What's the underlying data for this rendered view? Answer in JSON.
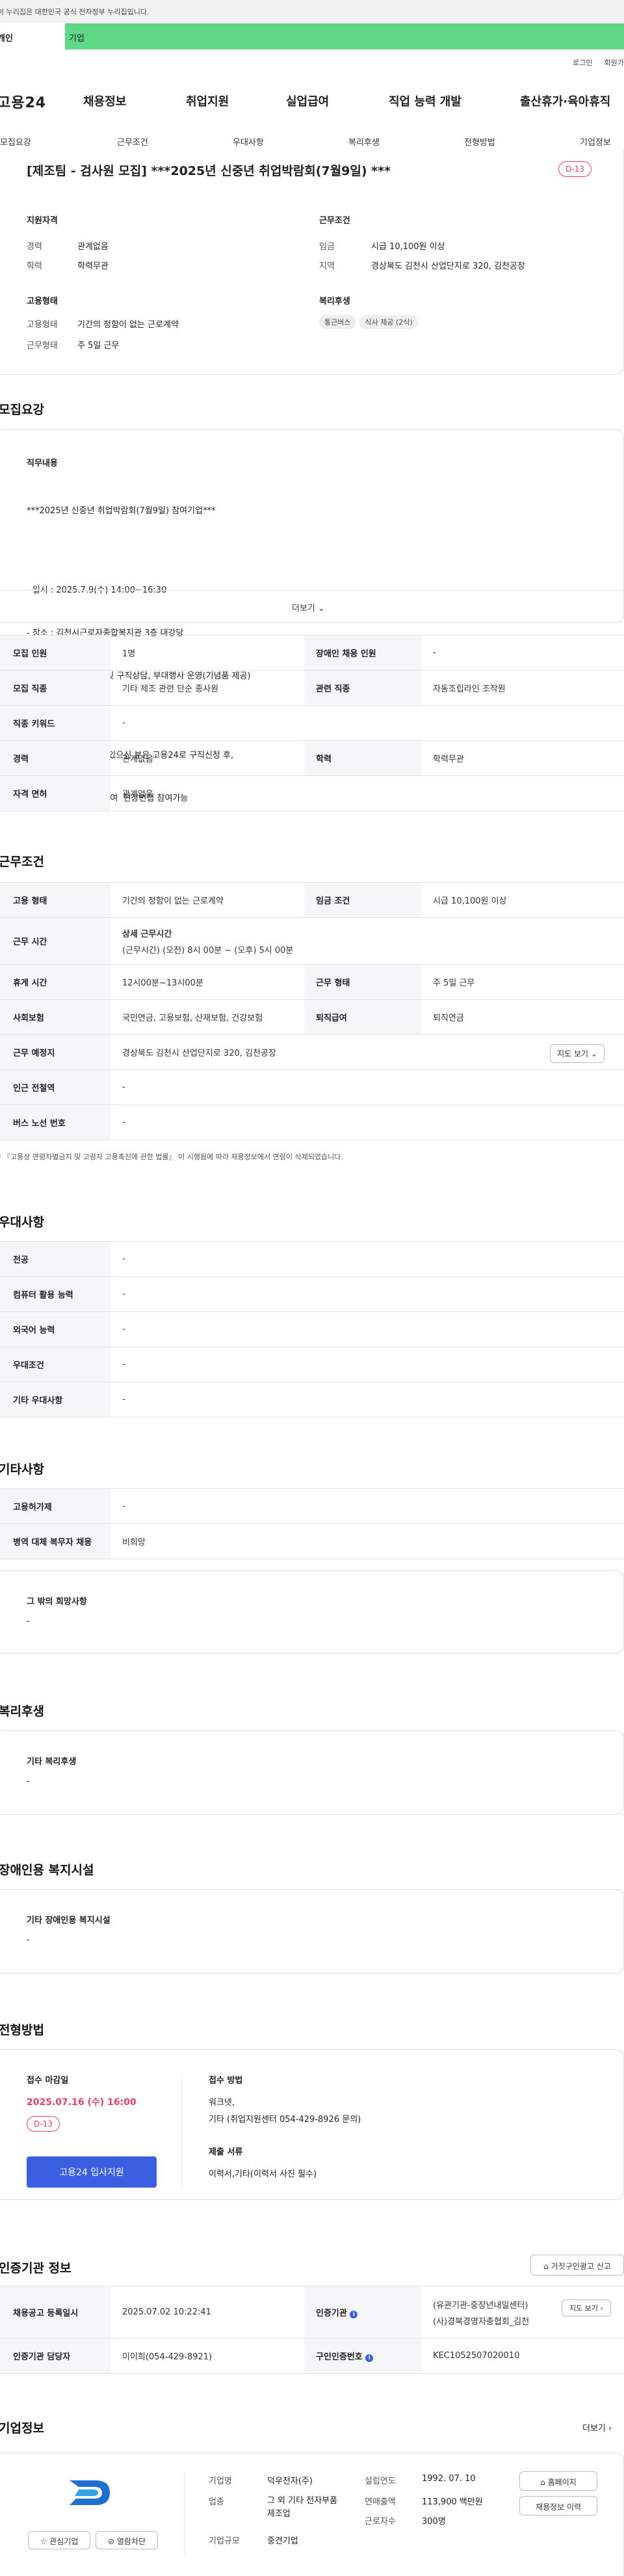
{
  "gov_banner": "이 누리집은 대한민국 공식 전자정부 누리집입니다.",
  "top_tabs": {
    "individual": "개인",
    "company": "기업"
  },
  "utility": {
    "login": "로그인",
    "join": "회원가입"
  },
  "gnb": {
    "logo": "고용24",
    "menu": [
      "채용정보",
      "취업지원",
      "실업급여",
      "직업 능력 개발",
      "출산휴가·육아휴직"
    ]
  },
  "subnav": [
    "모집요강",
    "근무조건",
    "우대사항",
    "복리후생",
    "전형방법",
    "기업정보"
  ],
  "header": {
    "title": "[제조팀 - 검사원 모집] ***2025년 신중년 취업박람회(7월9일) ***",
    "dday": "D-13",
    "qualification_title": "지원자격",
    "career_label": "경력",
    "career_value": "관계없음",
    "edu_label": "학력",
    "edu_value": "학력무관",
    "employ_title": "고용형태",
    "employ_type_label": "고용형태",
    "employ_type_value": "기간의 정함이 없는 근로계약",
    "work_type_label": "근무형태",
    "work_type_value": "주 5일 근무",
    "cond_title": "근무조건",
    "wage_label": "임금",
    "wage_value": "시급 10,100원 이상",
    "region_label": "지역",
    "region_value": "경상북도 김천시 산업단지로 320, 김천공장",
    "welfare_title": "복리후생",
    "welfare_tags": [
      "통근버스",
      "식사 제공 (2식)"
    ]
  },
  "recruit": {
    "section_title": "모집요강",
    "duty_title": "직무내용",
    "lines": [
      "***2025년 신중년 취업박람회(7월9일) 참여기업***",
      "",
      "- 일시 : 2025.7.9(수) 14:00~16:30",
      "- 장소 : 김천시근로자종합복지관 3층 대강당",
      "- 내용 : 1:1 현장면접 및 구직상담, 부대행사 운영(기념품 제공)",
      "",
      "- 지원방법 : 지원 의사 있으신 분은 고용24로 구직신청 후,",
      "  이력서, 신분증 지참하여  현장면접 참여가능"
    ],
    "more": "더보기",
    "rows": [
      {
        "h1": "모집 인원",
        "v1": "1명",
        "h2": "장애인 채용 인원",
        "v2": "-"
      },
      {
        "h1": "모집 직종",
        "v1": "기타 제조 관련 단순 종사원",
        "h2": "관련 직종",
        "v2": "자동조립라인 조작원"
      },
      {
        "h1": "직종 키워드",
        "v1": "-"
      },
      {
        "h1": "경력",
        "v1": "관계없음",
        "h2": "학력",
        "v2": "학력무관"
      },
      {
        "h1": "자격 면허",
        "v1": "관계없음"
      }
    ]
  },
  "work": {
    "section_title": "근무조건",
    "employ_h": "고용 형태",
    "employ_v": "기간의 정함이 없는 근로계약",
    "wage_h": "임금 조건",
    "wage_v": "시급 10,100원 이상",
    "time_h": "근무 시간",
    "time_title": "상세 근무시간",
    "time_v": "(근무시간) (오전) 8시 00분 ~ (오후) 5시 00분",
    "rest_h": "휴게 시간",
    "rest_v": "12시00분~13시00분",
    "worktype_h": "근무 형태",
    "worktype_v": "주 5일 근무",
    "insurance_h": "사회보험",
    "insurance_v": "국민연금, 고용보험, 산재보험, 건강보험",
    "retire_h": "퇴직급여",
    "retire_v": "퇴직연금",
    "place_h": "근무 예정지",
    "place_v": "경상북도 김천시 산업단지로 320, 김천공장",
    "map_btn": "지도 보기",
    "subway_h": "인근 전철역",
    "subway_v": "-",
    "bus_h": "버스 노선 번호",
    "bus_v": "-",
    "notice": "* 『고용상 연령차별금지 및 고령자 고용촉진에 관한 법률』 이 시행됨에 따라 채용정보에서 연령이 삭제되었습니다."
  },
  "pref": {
    "section_title": "우대사항",
    "rows": [
      {
        "h": "전공",
        "v": "-"
      },
      {
        "h": "컴퓨터 활용 능력",
        "v": "-"
      },
      {
        "h": "외국어 능력",
        "v": "-"
      },
      {
        "h": "우대조건",
        "v": "-"
      },
      {
        "h": "기타 우대사항",
        "v": "-"
      }
    ]
  },
  "etc": {
    "section_title": "기타사항",
    "rows": [
      {
        "h": "고용허가제",
        "v": "-"
      },
      {
        "h": "병역 대체 복무자 채용",
        "v": "비희망"
      }
    ],
    "other_title": "그 밖의 희망사항",
    "other_v": "-"
  },
  "welfare": {
    "section_title": "복리후생",
    "box_title": "기타 복리후생",
    "box_v": "-"
  },
  "disability": {
    "section_title": "장애인용 복지시설",
    "box_title": "기타 장애인용 복지시설",
    "box_v": "-"
  },
  "process": {
    "section_title": "전형방법",
    "deadline_title": "접수 마감일",
    "deadline_v": "2025.07.16 (수) 16:00",
    "dday": "D-13",
    "apply_btn": "고용24 입사지원",
    "method_title": "접수 방법",
    "method_v1": "워크넷,",
    "method_v2": "기타 (취업지원센터 054-429-8926 문의)",
    "docs_title": "제출 서류",
    "docs_v": "이력서,기타(이력서 사진 필수)"
  },
  "cert": {
    "section_title": "인증기관 정보",
    "report_btn": "거짓구인광고 신고",
    "reg_h": "채용공고 등록일시",
    "reg_v": "2025.07.02 10:22:41",
    "org_h": "인증기관",
    "org_v1": "(유관기관-중장년내일센터)",
    "org_v2": "(사)경북경영자총협회_김천",
    "map_btn": "지도 보기",
    "manager_h": "인증기관 담당자",
    "manager_v": "이이희(054-429-8921)",
    "id_h": "구인인증번호",
    "id_v": "KEC1052507020010"
  },
  "company": {
    "section_title": "기업정보",
    "more": "더보기",
    "fav_btn": "관심기업",
    "block_btn": "열람차단",
    "name_h": "기업명",
    "name_v": "덕우전자(주)",
    "industry_h": "업종",
    "industry_v": "그 외 기타 전자부품 제조업",
    "size_h": "기업규모",
    "size_v": "중견기업",
    "founded_h": "설립연도",
    "founded_v": "1992. 07. 10",
    "sales_h": "연매출액",
    "sales_v": "113,900 백만원",
    "staff_h": "근로자수",
    "staff_v": "300명",
    "homepage_btn": "홈페이지",
    "history_btn": "채용정보 이력"
  },
  "colors": {
    "accent": "#3a5fe0",
    "dday": "#e54166",
    "corp_tab": "#5fd784"
  }
}
